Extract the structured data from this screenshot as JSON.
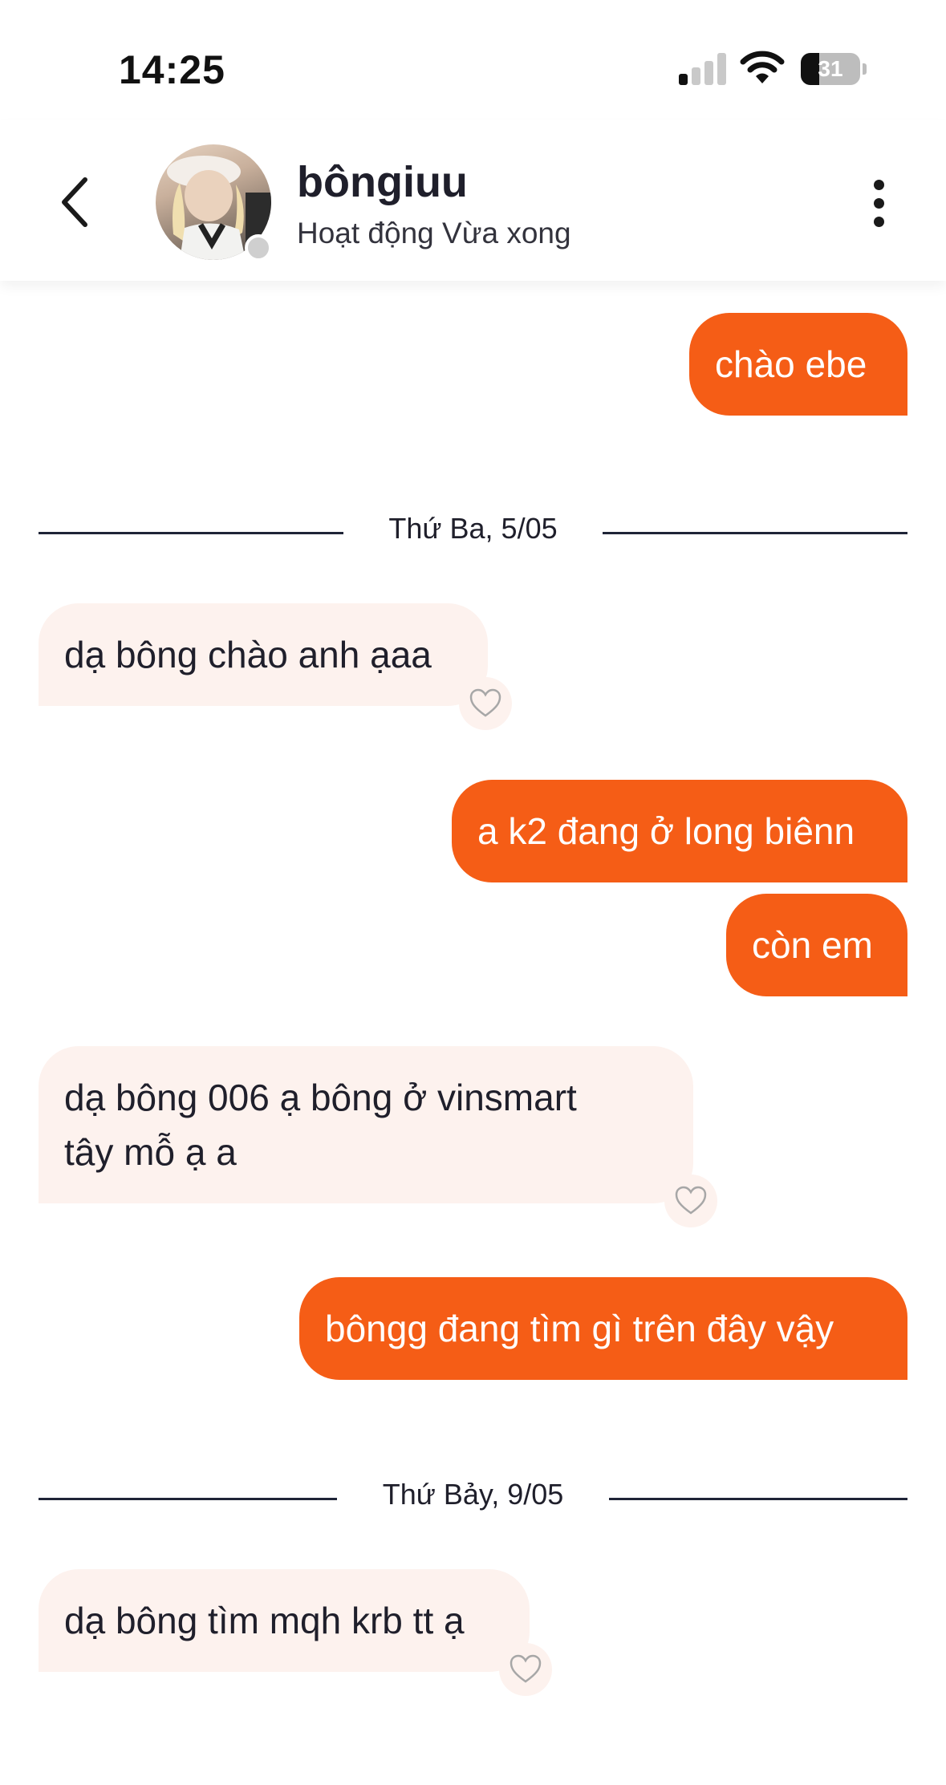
{
  "status_bar": {
    "time": "14:25",
    "battery": "31",
    "battery_level": 0.31,
    "signal_bars": 1
  },
  "header": {
    "name": "bôngiuu",
    "status": "Hoạt động Vừa xong"
  },
  "messages": [
    {
      "direction": "sent",
      "text": "chào ebe"
    },
    {
      "type": "date",
      "text": "Thứ Ba, 5/05"
    },
    {
      "direction": "received",
      "text": "dạ bông chào anh ạaa"
    },
    {
      "direction": "sent",
      "text": "a k2 đang ở long biênn"
    },
    {
      "direction": "sent",
      "text": "còn em"
    },
    {
      "direction": "received",
      "text": "dạ bông 006 ạ bông ở vinsmart\ntây mỗ ạ a"
    },
    {
      "direction": "sent",
      "text": "bôngg đang tìm gì trên đây vậy"
    },
    {
      "type": "date",
      "text": "Thứ Bảy, 9/05"
    },
    {
      "direction": "received",
      "text": "dạ bông tìm mqh krb tt ạ"
    }
  ],
  "colors": {
    "sent_bubble": "#f55d16",
    "received_bubble": "#fdf2ee",
    "text_dark": "#1f1f2b"
  },
  "icons": {
    "back": "chevron-left-icon",
    "more": "more-vertical-icon",
    "like": "heart-icon",
    "wifi": "wifi-icon",
    "signal": "cellular-signal-icon",
    "battery": "battery-icon"
  }
}
